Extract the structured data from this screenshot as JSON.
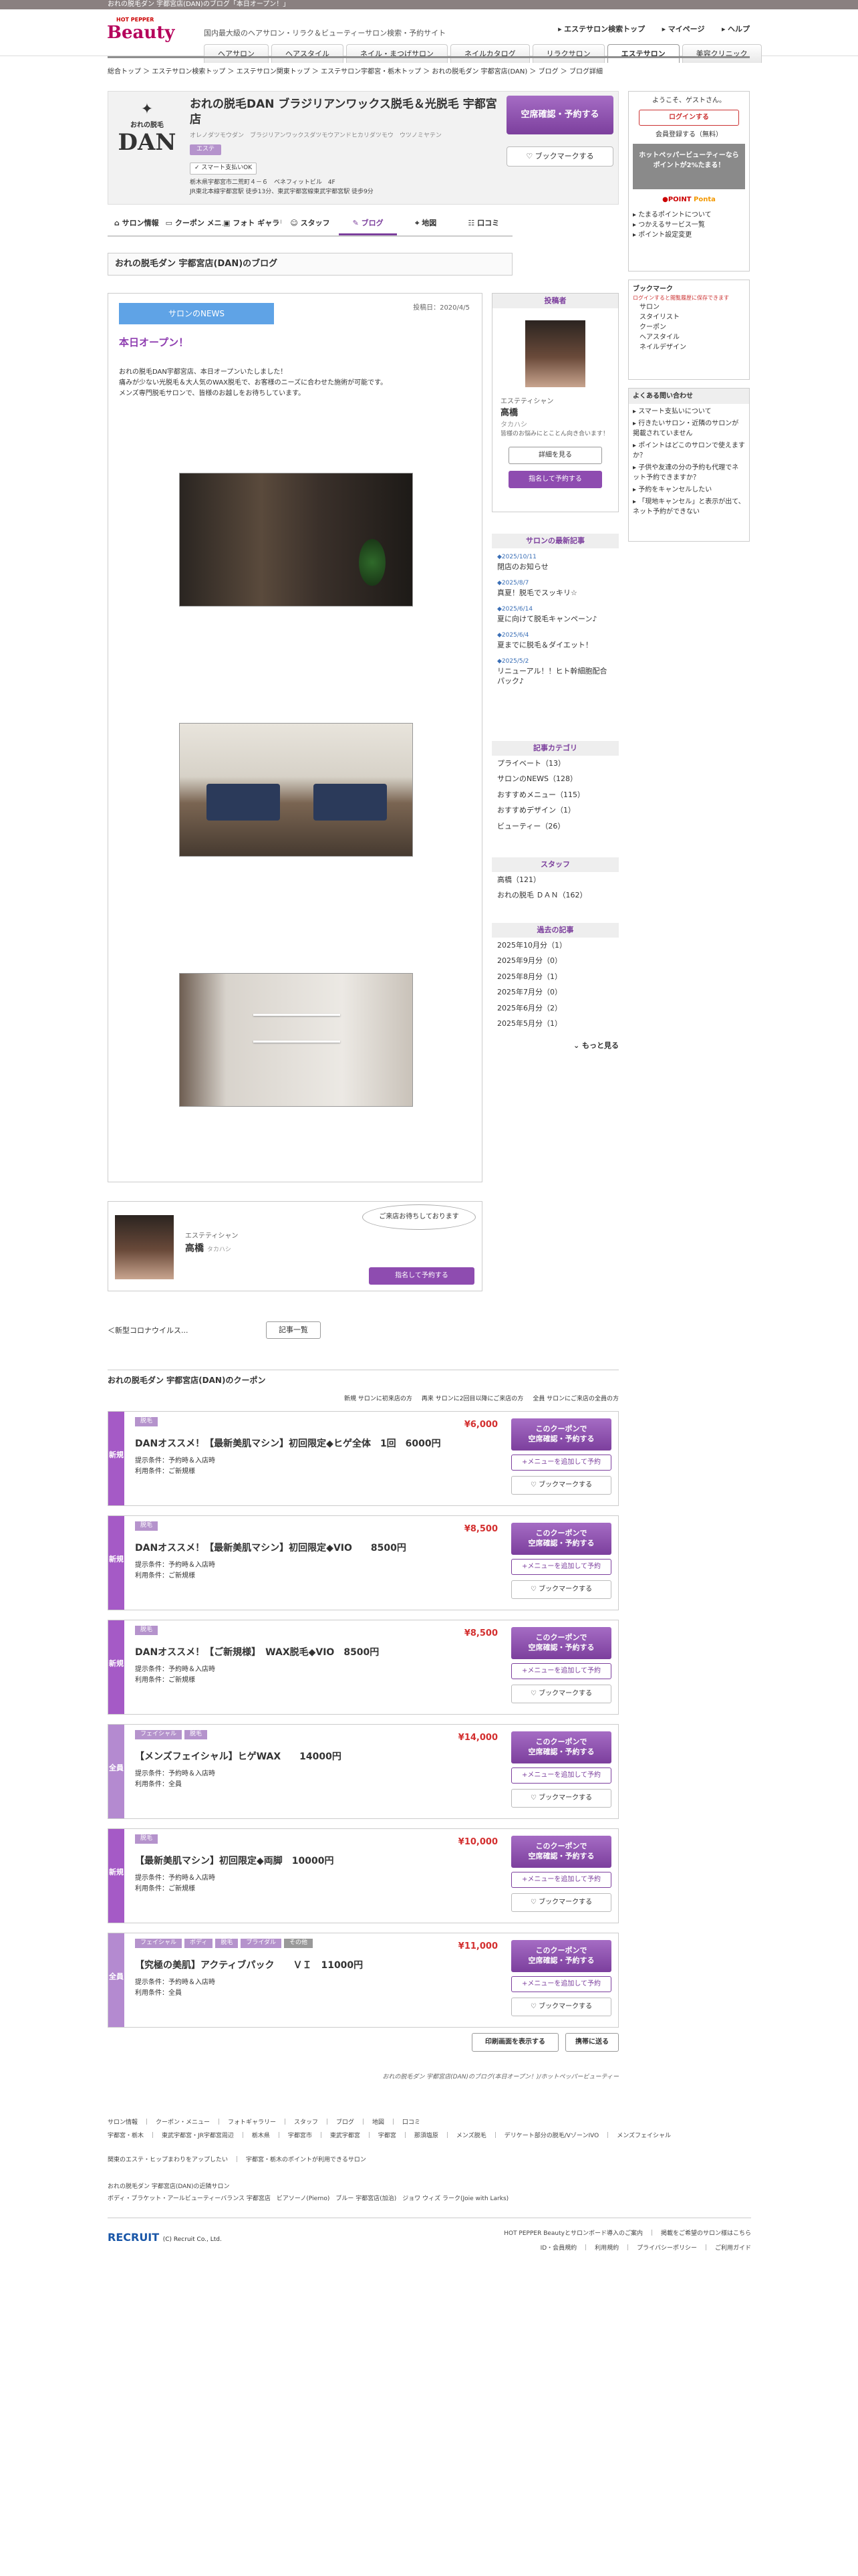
{
  "topbar": "おれの脱毛ダン 宇都宮店(DAN)のブログ「本日オープン！」",
  "header": {
    "logo_small": "HOT PEPPER",
    "logo_big": "Beauty",
    "tagline": "国内最大級のヘアサロン・リラク＆ビューティーサロン検索・予約サイト",
    "util": [
      "エステサロン検索トップ",
      "マイページ",
      "ヘルプ"
    ],
    "gnav": [
      "ヘアサロン",
      "ヘアスタイル",
      "ネイル・まつげサロン",
      "ネイルカタログ",
      "リラクサロン",
      "エステサロン",
      "美容クリニック"
    ]
  },
  "crumb": "総合トップ ＞ エステサロン検索トップ ＞ エステサロン関東トップ ＞ エステサロン宇都宮・栃木トップ ＞ おれの脱毛ダン 宇都宮店(DAN) ＞ ブログ ＞ ブログ詳細",
  "salon": {
    "name": "おれの脱毛DAN ブラジリアンワックス脱毛＆光脱毛 宇都宮店",
    "kana": "オレノダツモウダン　ブラジリアンワックスダツモウアンドヒカリダツモウ　ウツノミヤテン",
    "tag": "エステ",
    "smart": "スマート支払いOK",
    "address": "栃木県宇都宮市二荒町４－６　ベネフィットビル　4F",
    "access": "JR東北本線宇都宮駅 徒歩13分、東武宇都宮線東武宇都宮駅 徒歩9分",
    "logo_text": "DAN",
    "logo_sub": "おれの脱毛",
    "reserve": "空席確認・予約する",
    "bookmark": "ブックマークする"
  },
  "tabs": [
    "サロン情報",
    "クーポン メニュー",
    "フォト ギャラリー",
    "スタッフ",
    "ブログ",
    "地図",
    "口コミ"
  ],
  "section_title": "おれの脱毛ダン 宇都宮店(DAN)のブログ",
  "blog": {
    "category": "サロンのNEWS",
    "date": "投稿日：2020/4/5",
    "title": "本日オープン！",
    "body": "おれの脱毛DAN宇都宮店、本日オープンいたしました！\n痛みが少ない光脱毛＆大人気のWAX脱毛で、お客様のニーズに合わせた施術が可能です。\nメンズ専門脱毛サロンで、皆様のお越しをお待ちしています。"
  },
  "author": {
    "head": "投稿者",
    "role": "エステティシャン",
    "name": "高橋",
    "kana": "タカハシ",
    "desc": "皆様のお悩みにとことん向き合います！",
    "detail": "詳細を見る",
    "reserve": "指名して予約する"
  },
  "recent": {
    "head": "サロンの最新記事",
    "items": [
      {
        "date": "2025/10/11",
        "title": "閉店のお知らせ"
      },
      {
        "date": "2025/8/7",
        "title": "真夏！脱毛でスッキリ☆"
      },
      {
        "date": "2025/6/14",
        "title": "夏に向けて脱毛キャンペーン♪"
      },
      {
        "date": "2025/6/4",
        "title": "夏までに脱毛＆ダイエット！"
      },
      {
        "date": "2025/5/2",
        "title": "リニューアル！！ヒト幹細胞配合パック♪"
      }
    ]
  },
  "cats": {
    "head": "記事カテゴリ",
    "items": [
      "プライベート（13）",
      "サロンのNEWS（128）",
      "おすすめメニュー（115）",
      "おすすめデザイン（1）",
      "ビューティー（26）"
    ]
  },
  "staff": {
    "head": "スタッフ",
    "items": [
      "高橋（121）",
      "おれの脱毛 ＤＡＮ（162）"
    ]
  },
  "archive": {
    "head": "過去の記事",
    "items": [
      "2025年10月分（1）",
      "2025年9月分（0）",
      "2025年8月分（1）",
      "2025年7月分（0）",
      "2025年6月分（2）",
      "2025年5月分（1）"
    ],
    "more": "もっと見る"
  },
  "staffcard": {
    "bubble": "ご来店お待ちしております",
    "role": "エステティシャン",
    "name": "高橋",
    "kana": "タカハシ",
    "reserve": "指名して予約する"
  },
  "prevlink": "＜新型コロナウイルス...",
  "listbtn": "記事一覧",
  "coupon_title": "おれの脱毛ダン 宇都宮店(DAN)のクーポン",
  "legend": [
    "新規 サロンに初来店の方",
    "再来 サロンに2回目以降にご来店の方",
    "全員 サロンにご来店の全員の方"
  ],
  "coupons": [
    {
      "type": "新規",
      "tags": [
        "脱毛"
      ],
      "price": "¥6,000",
      "name": "DANオススメ！【最新美肌マシン】初回限定◆ヒゲ全体　1回　6000円",
      "cond": "提示条件：予約時＆入店時",
      "use": "利用条件：ご新規様"
    },
    {
      "type": "新規",
      "tags": [
        "脱毛"
      ],
      "price": "¥8,500",
      "name": "DANオススメ！【最新美肌マシン】初回限定◆VIO　　8500円",
      "cond": "提示条件：予約時＆入店時",
      "use": "利用条件：ご新規様"
    },
    {
      "type": "新規",
      "tags": [
        "脱毛"
      ],
      "price": "¥8,500",
      "name": "DANオススメ！【ご新規様】　WAX脱毛◆VIO　8500円",
      "cond": "提示条件：予約時＆入店時",
      "use": "利用条件：ご新規様"
    },
    {
      "type": "全員",
      "tags": [
        "フェイシャル",
        "脱毛"
      ],
      "price": "¥14,000",
      "name": "【メンズフェイシャル】ヒゲWAX　　14000円",
      "cond": "提示条件：予約時＆入店時",
      "use": "利用条件：全員"
    },
    {
      "type": "新規",
      "tags": [
        "脱毛"
      ],
      "price": "¥10,000",
      "name": "【最新美肌マシン】初回限定◆両脚　10000円",
      "cond": "提示条件：予約時＆入店時",
      "use": "利用条件：ご新規様"
    },
    {
      "type": "全員",
      "tags": [
        "フェイシャル",
        "ボディ",
        "脱毛",
        "ブライダル",
        "その他"
      ],
      "price": "¥11,000",
      "name": "【究極の美肌】アクティブパック　　ＶＩ　11000円",
      "cond": "提示条件：予約時＆入店時",
      "use": "利用条件：全員"
    }
  ],
  "coupon_buttons": {
    "reserve": "このクーポンで\n空席確認・予約する",
    "add": "+メニューを追加して予約",
    "bookmark": "ブックマークする"
  },
  "print": "印刷画面を表示する",
  "mobile": "携帯に送る",
  "footer": {
    "copy": "おれの脱毛ダン 宇都宮店(DAN)のブログ(本日オープン！)/ホットペッパービューティー",
    "links1": "サロン情報　｜　クーポン・メニュー　｜　フォトギャラリー　｜　スタッフ　｜　ブログ　｜　地図　｜　口コミ",
    "links2": "宇都宮・栃木　｜　東武宇都宮・JR宇都宮周辺　｜　栃木県　｜　宇都宮市　｜　東武宇都宮　｜　宇都宮　｜　那須塩原　｜　メンズ脱毛　｜　デリケート部分の脱毛/VゾーンIVO　｜　メンズフェイシャル",
    "points": "関東のエステ・ヒップまわりをアップしたい　｜　宇都宮・栃木のポイントが利用できるサロン",
    "related": "おれの脱毛ダン 宇都宮店(DAN)の近隣サロン",
    "related2": "ボディ・ブラケット・アールビューティーバランス 宇都宮店　ビアソーノ(Pierno)　ブルー 宇都宮店(加治)　ジョワ ウィズ ラーク(Joie with Larks)",
    "recruit": "RECRUIT",
    "copyright": "(C) Recruit Co., Ltd.",
    "r1": "HOT PEPPER Beautyとサロンボード導入のご案内　｜　掲載をご希望のサロン様はこちら",
    "r2": "ID・会員規約　｜　利用規約　｜　プライバシーポリシー　｜　ご利用ガイド"
  },
  "rightbox": {
    "greet": "ようこそ、ゲストさん。",
    "login": "ログインする",
    "register": "会員登録する（無料）",
    "promo": "ホットペッパービューティーならポイントが2%たまる！",
    "links": [
      "たまるポイントについて",
      "つかえるサービス一覧",
      "ポイント設定変更"
    ],
    "bm_head": "ブックマーク",
    "bm_note": "ログインすると閲覧履歴に保存できます",
    "bm_items": [
      "サロン",
      "スタイリスト",
      "クーポン",
      "ヘアスタイル",
      "ネイルデザイン"
    ],
    "faq_head": "よくある問い合わせ",
    "faq": [
      "スマート支払いについて",
      "行きたいサロン・近隣のサロンが掲載されていません",
      "ポイントはどこのサロンで使えますか？",
      "子供や友達の分の予約も代理でネット予約できますか？",
      "予約をキャンセルしたい",
      "「現地キャンセル」と表示が出て、ネット予約ができない"
    ]
  },
  "colors": {
    "accent": "#7c3f9d",
    "blue": "#5fa3e6",
    "price": "#d32f2f"
  }
}
